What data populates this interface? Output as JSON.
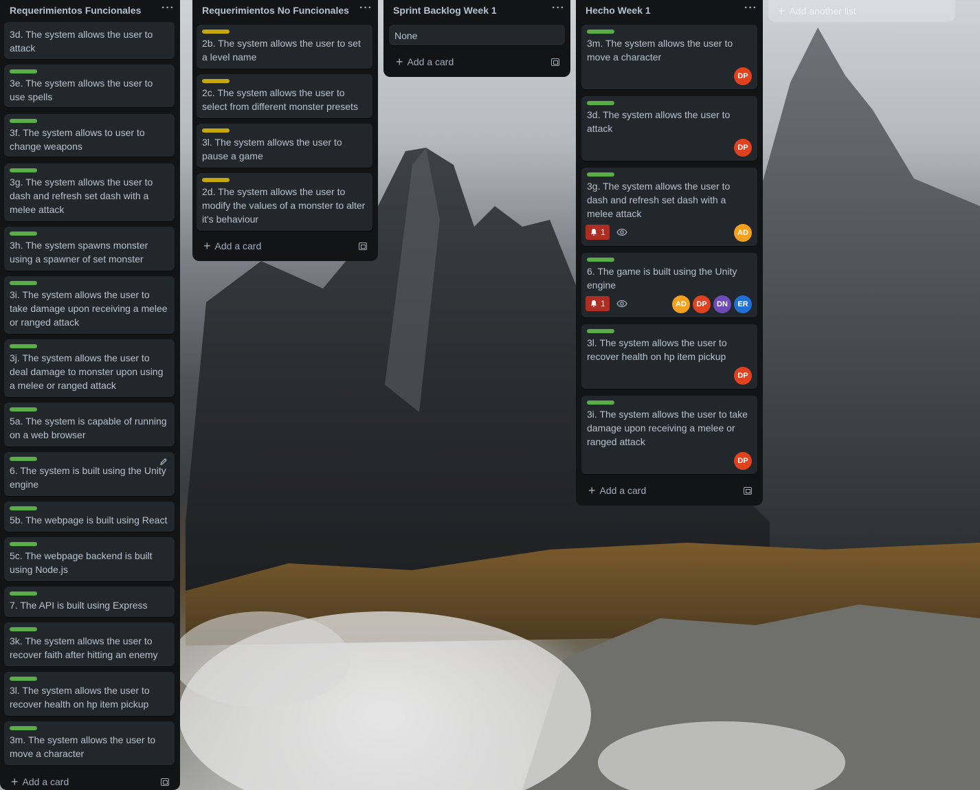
{
  "lists": [
    {
      "title": "Requerimientos Funcionales",
      "menu": "···",
      "add_card": "Add a card",
      "cards": [
        {
          "label": "green",
          "text": "3d. The system allows the user to attack"
        },
        {
          "label": "green",
          "text": "3e. The system allows the user to use spells"
        },
        {
          "label": "green",
          "text": "3f. The system allows to user to change weapons"
        },
        {
          "label": "green",
          "text": "3g. The system allows the user to dash and refresh set dash with a melee attack"
        },
        {
          "label": "green",
          "text": "3h. The system spawns monster using a spawner of set monster"
        },
        {
          "label": "green",
          "text": "3i. The system allows the user to take damage upon receiving a melee or ranged attack"
        },
        {
          "label": "green",
          "text": "3j. The system allows the user to deal damage to monster upon using a melee or ranged attack"
        },
        {
          "label": "green",
          "text": "5a. The system is capable of running on a web browser"
        },
        {
          "label": "green",
          "text": "6. The system is built using the Unity engine"
        },
        {
          "label": "green",
          "text": "5b. The webpage is built using React"
        },
        {
          "label": "green",
          "text": "5c. The webpage backend is built using Node.js"
        },
        {
          "label": "green",
          "text": "7. The API is built using Express"
        },
        {
          "label": "green",
          "text": "3k. The system allows the user to recover faith after hitting an enemy"
        },
        {
          "label": "green",
          "text": "3l. The system allows the user to recover health on hp item pickup"
        },
        {
          "label": "green",
          "text": "3m. The system allows the user to move a character"
        }
      ]
    },
    {
      "title": "Requerimientos No Funcionales",
      "menu": "···",
      "add_card": "Add a card",
      "cards": [
        {
          "label": "yellow",
          "text": "2b. The system allows the user to set a level name"
        },
        {
          "label": "yellow",
          "text": "2c. The system allows the user to select from different monster presets"
        },
        {
          "label": "yellow",
          "text": "3l. The system allows the user to pause a game"
        },
        {
          "label": "yellow",
          "text": "2d. The system allows the user to modify the values of a monster to alter it's behaviour"
        }
      ]
    },
    {
      "title": "Sprint Backlog Week 1",
      "menu": "···",
      "add_card": "Add a card",
      "cards": [
        {
          "label": "",
          "text": "None"
        }
      ]
    },
    {
      "title": "Hecho Week 1",
      "menu": "···",
      "add_card": "Add a card",
      "cards": [
        {
          "label": "green",
          "text": "3m. The system allows the user to move a character",
          "members": [
            "DP"
          ]
        },
        {
          "label": "green",
          "text": "3d. The system allows the user to attack",
          "members": [
            "DP"
          ]
        },
        {
          "label": "green",
          "text": "3g. The system allows the user to dash and refresh set dash with a melee attack",
          "notifications": "1",
          "members": [
            "AD"
          ]
        },
        {
          "label": "green",
          "text": "6. The game is built using the Unity engine",
          "notifications": "1",
          "members": [
            "AD",
            "DP",
            "DN",
            "ER"
          ]
        },
        {
          "label": "green",
          "text": "3l. The system allows the user to recover health on hp item pickup",
          "members": [
            "DP"
          ]
        },
        {
          "label": "green",
          "text": "3i. The system allows the user to take damage upon receiving a melee or ranged attack",
          "members": [
            "DP"
          ]
        }
      ]
    }
  ],
  "add_list": "Add another list",
  "colors": {
    "label_green": "#5aac44",
    "label_yellow": "#c7a80b",
    "avatar_DP": "#e0411f",
    "avatar_AD": "#f2a01e",
    "avatar_DN": "#6e4bb8",
    "avatar_ER": "#1f6fd6",
    "notification_badge": "#ae2e24"
  }
}
